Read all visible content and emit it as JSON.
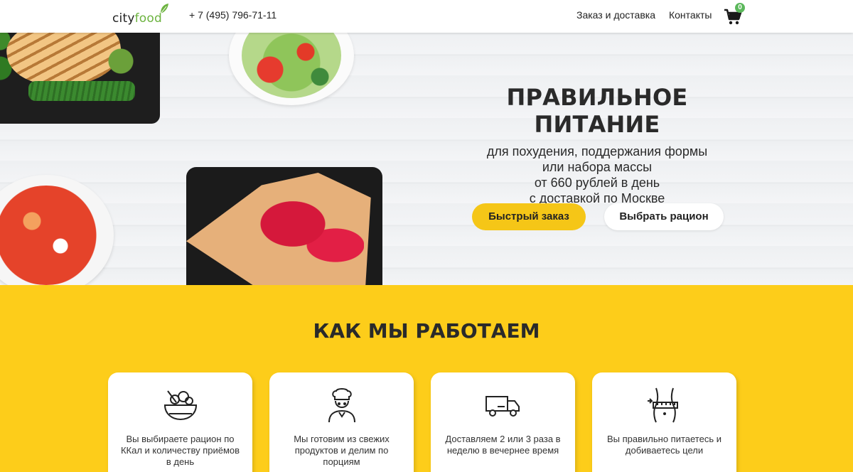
{
  "header": {
    "logo_city": "city",
    "logo_food": "food",
    "phone": "+ 7 (495) 796-71-11",
    "nav": [
      {
        "label": "Заказ и доставка"
      },
      {
        "label": "Контакты"
      }
    ],
    "cart_count": "0",
    "cart_icon": "cart-icon"
  },
  "hero": {
    "title": "ПРАВИЛЬНОЕ ПИТАНИЕ",
    "lines": [
      "для похудения, поддержания формы",
      "или набора массы",
      "от 660 рублей в день",
      "с доставкой по Москве"
    ],
    "quick_order": "Быстрый заказ",
    "choose_plan": "Выбрать рацион"
  },
  "how": {
    "title": "КАК МЫ РАБОТАЕМ",
    "steps": [
      {
        "icon": "salad-bowl-icon",
        "text": "Вы выбираете рацион по ККал и количеству приёмов в день"
      },
      {
        "icon": "chef-icon",
        "text": "Мы готовим из свежих продуктов и делим по порциям"
      },
      {
        "icon": "delivery-truck-icon",
        "text": "Доставляем 2 или 3 раза в неделю в вечернее время"
      },
      {
        "icon": "waist-measure-icon",
        "text": "Вы правильно питаетесь и добиваетесь цели"
      }
    ]
  },
  "colors": {
    "brand_yellow": "#fdcd1a",
    "button_yellow": "#f5c617",
    "logo_green": "#6cb33f",
    "badge_green": "#5cb85c"
  }
}
